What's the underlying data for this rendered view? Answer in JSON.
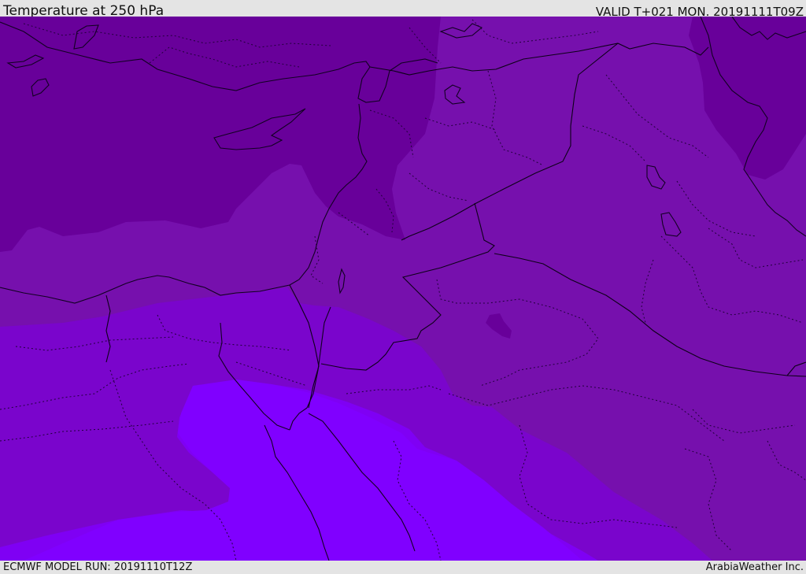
{
  "header": {
    "title": "Temperature at 250 hPa",
    "valid_time": "VALID T+021 MON. 20191111T09Z"
  },
  "footer": {
    "model_run": "ECMWF MODEL RUN: 20191110T12Z",
    "credit": "ArabiaWeather Inc."
  },
  "map": {
    "region": "Eastern Mediterranean / Middle East",
    "colors": {
      "zone_coldest": "#68009a",
      "zone_cold": "#7610ad",
      "zone_mid": "#7a05cc",
      "zone_warm": "#7f00f4",
      "zone_warmest": "#8000ff",
      "coastline": "#120022",
      "border": "#0d0018",
      "admin_border": "#20003a"
    }
  }
}
